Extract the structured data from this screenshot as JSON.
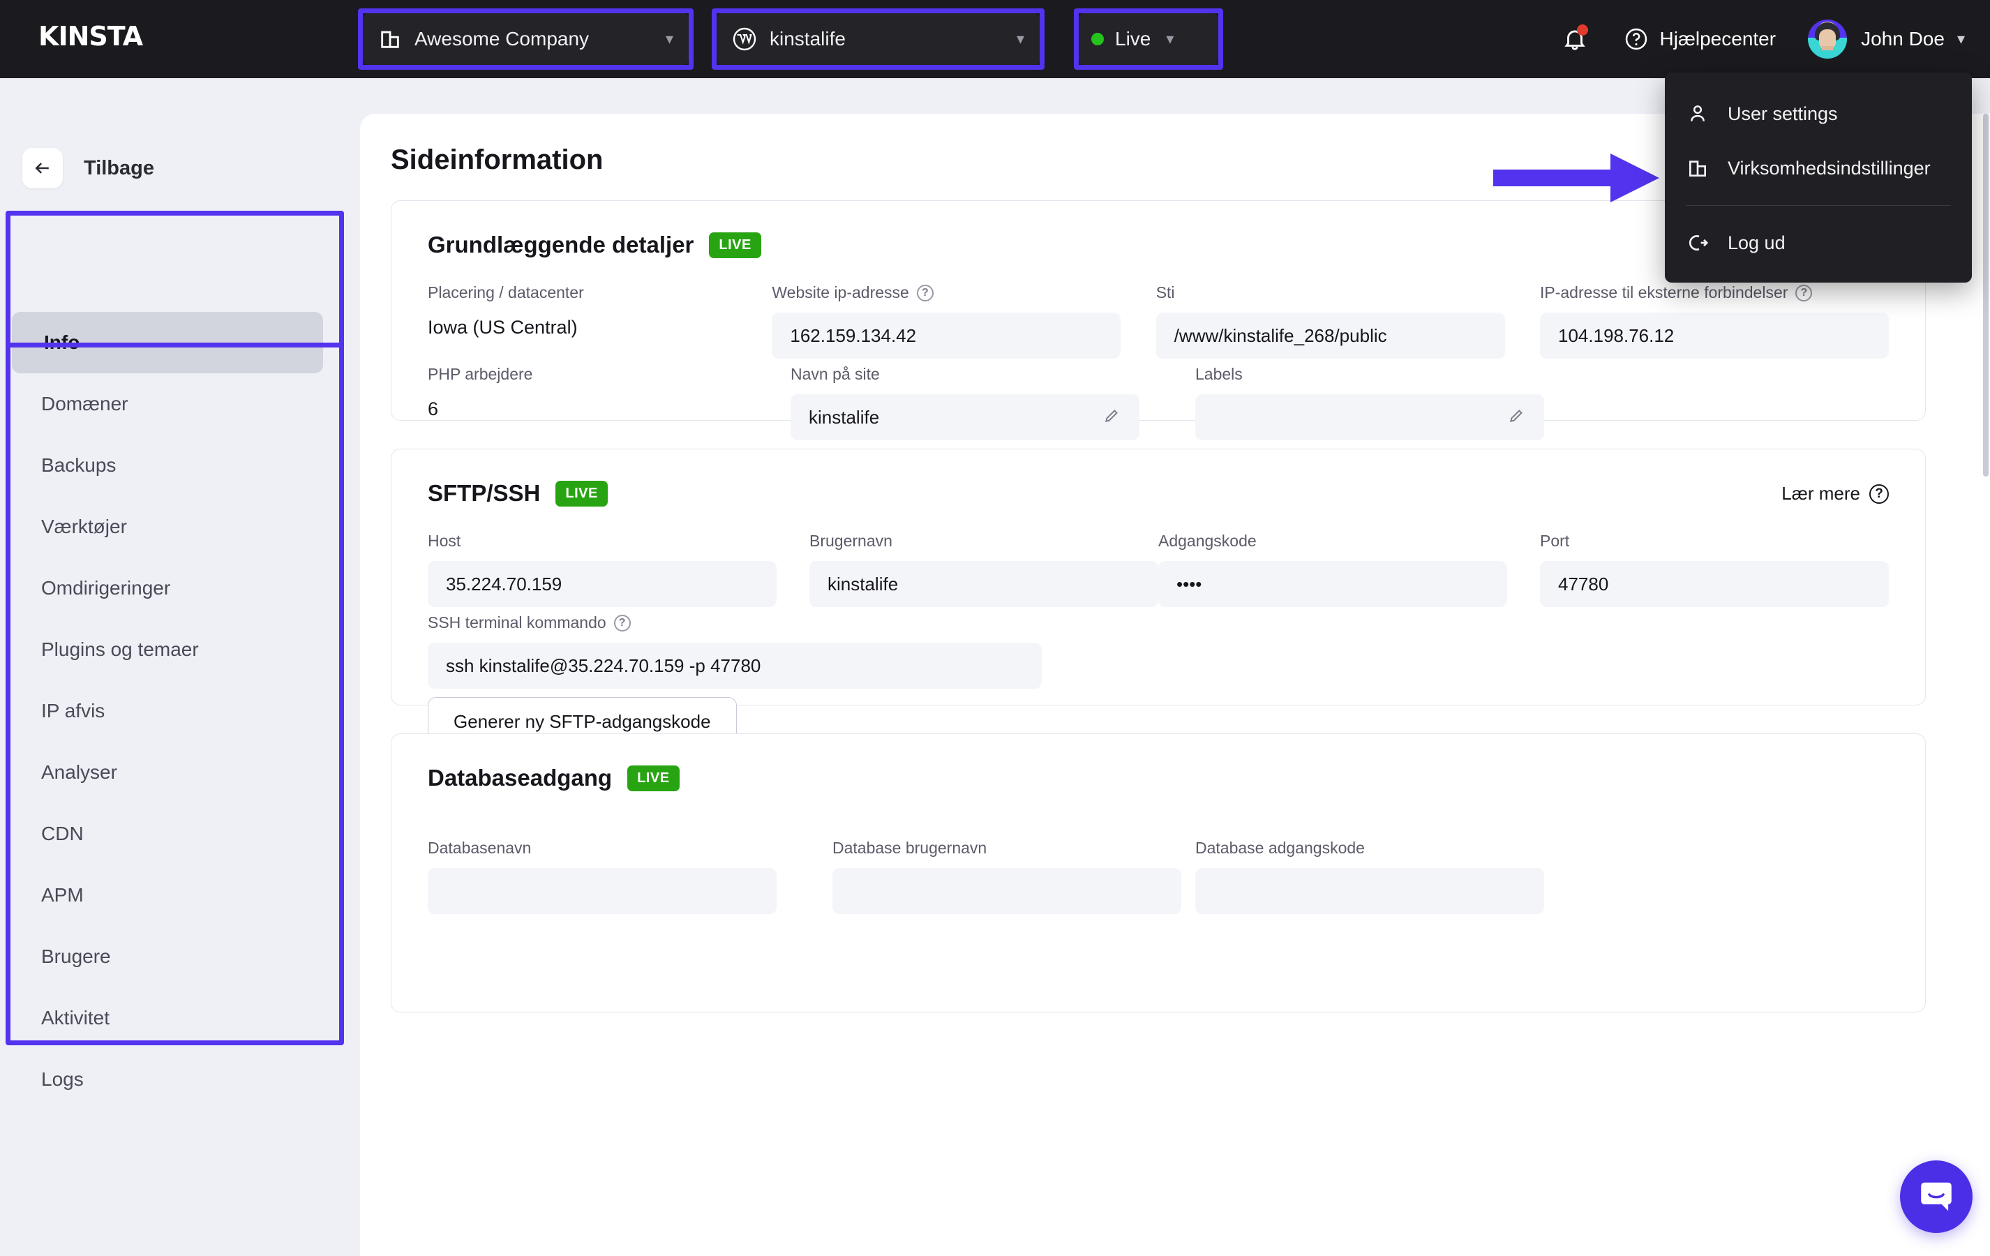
{
  "brand": {
    "name": "KINSTA",
    "accent": "#5333ed"
  },
  "topbar": {
    "company_selector": {
      "label": "Awesome Company",
      "icon": "company-building-icon",
      "chevron": "chevron-down-icon"
    },
    "site_selector": {
      "label": "kinstalife",
      "icon": "wordpress-icon",
      "chevron": "chevron-down-icon"
    },
    "environment_selector": {
      "label": "Live",
      "status_color": "#24c31e",
      "chevron": "chevron-down-icon"
    },
    "notifications": {
      "icon": "bell-icon",
      "has_unread": true,
      "dot_color": "#e33a2e"
    },
    "help": {
      "label": "Hjælpecenter",
      "icon": "question-circle-icon"
    },
    "user": {
      "name": "John Doe",
      "chevron": "chevron-down-icon",
      "avatar": "user-avatar"
    }
  },
  "user_menu": {
    "items": [
      {
        "label": "User settings",
        "icon": "person-icon"
      },
      {
        "label": "Virksomhedsindstillinger",
        "icon": "company-building-icon"
      },
      {
        "label": "Log ud",
        "icon": "logout-icon"
      }
    ]
  },
  "sidebar": {
    "back": {
      "label": "Tilbage",
      "icon": "arrow-left-icon"
    },
    "items": [
      {
        "label": "Info",
        "active": true
      },
      {
        "label": "Domæner",
        "active": false
      },
      {
        "label": "Backups",
        "active": false
      },
      {
        "label": "Værktøjer",
        "active": false
      },
      {
        "label": "Omdirigeringer",
        "active": false
      },
      {
        "label": "Plugins og temaer",
        "active": false
      },
      {
        "label": "IP afvis",
        "active": false
      },
      {
        "label": "Analyser",
        "active": false
      },
      {
        "label": "CDN",
        "active": false
      },
      {
        "label": "APM",
        "active": false
      },
      {
        "label": "Brugere",
        "active": false
      },
      {
        "label": "Aktivitet",
        "active": false
      },
      {
        "label": "Logs",
        "active": false
      }
    ]
  },
  "main": {
    "page_title": "Sideinformation",
    "cards": {
      "basic": {
        "title": "Grundlæggende detaljer",
        "badge": "LIVE",
        "fields_row1": [
          {
            "label": "Placering / datacenter",
            "value": "Iowa (US Central)",
            "style": "plain",
            "help": false
          },
          {
            "label": "Website ip-adresse",
            "value": "162.159.134.42",
            "style": "box",
            "help": true
          },
          {
            "label": "Sti",
            "value": "/www/kinstalife_268/public",
            "style": "box",
            "help": false
          },
          {
            "label": "IP-adresse til eksterne forbindelser",
            "value": "104.198.76.12",
            "style": "box",
            "help": true
          }
        ],
        "fields_row2": [
          {
            "label": "PHP arbejdere",
            "value": "6",
            "style": "plain",
            "help": false
          },
          {
            "label": "Navn på site",
            "value": "kinstalife",
            "style": "box",
            "help": false,
            "editable": true
          },
          {
            "label": "Labels",
            "value": "",
            "style": "box",
            "help": false,
            "editable": true
          }
        ]
      },
      "sftp": {
        "title": "SFTP/SSH",
        "badge": "LIVE",
        "learn_more": {
          "label": "Lær mere",
          "icon": "question-circle-icon"
        },
        "fields_row1": [
          {
            "label": "Host",
            "value": "35.224.70.159",
            "style": "box",
            "help": false
          },
          {
            "label": "Brugernavn",
            "value": "kinstalife",
            "style": "box",
            "help": false
          },
          {
            "label": "Adgangskode",
            "value": "••••",
            "style": "box",
            "help": false
          },
          {
            "label": "Port",
            "value": "47780",
            "style": "box",
            "help": false
          }
        ],
        "terminal": {
          "label": "SSH terminal kommando",
          "value": "ssh kinstalife@35.224.70.159 -p 47780",
          "help": true
        },
        "button": "Generer ny SFTP-adgangskode"
      },
      "database": {
        "title": "Databaseadgang",
        "badge": "LIVE",
        "field_labels": [
          "Databasenavn",
          "Database brugernavn",
          "Database adgangskode"
        ]
      }
    }
  },
  "annotations": {
    "highlight_color": "#5333ed",
    "arrow": {
      "direction": "right",
      "color": "#5333ed",
      "points_to": "Virksomhedsindstillinger"
    },
    "boxes": [
      "company-selector",
      "site-selector",
      "environment-selector",
      "sidebar-nav"
    ]
  },
  "chat": {
    "icon": "chat-bubble-icon",
    "color": "#4b2fe6"
  }
}
